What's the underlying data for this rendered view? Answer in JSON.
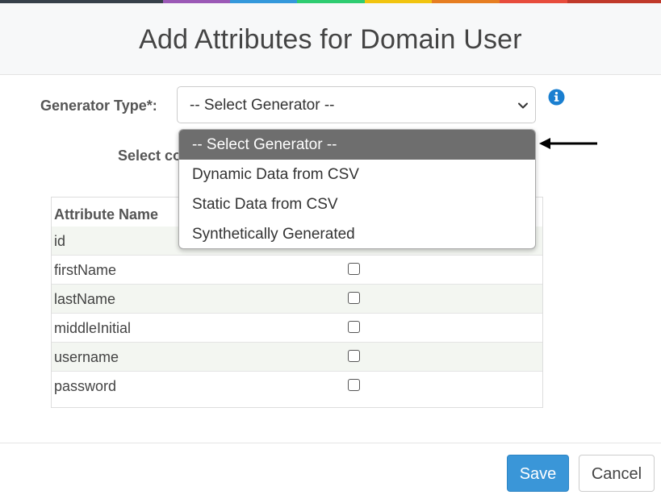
{
  "modal": {
    "title": "Add Attributes for Domain User"
  },
  "top_strip_colors": [
    "#37404a",
    "#37404a",
    "#9b59b6",
    "#3498db",
    "#2ecc71",
    "#f1c40f",
    "#e67e22",
    "#e74c3c",
    "#c0392b"
  ],
  "form": {
    "generator_type_label": "Generator Type*:",
    "generator_select_value": "-- Select Generator --",
    "select_column_label_partial": "Select co"
  },
  "dropdown": {
    "options": [
      "-- Select Generator --",
      "Dynamic Data from CSV",
      "Static Data from CSV",
      "Synthetically Generated"
    ],
    "highlighted_option": "-- Select Generator --"
  },
  "table": {
    "header": "Attribute Name",
    "rows": [
      {
        "name": "id",
        "checked": false
      },
      {
        "name": "firstName",
        "checked": false
      },
      {
        "name": "lastName",
        "checked": false
      },
      {
        "name": "middleInitial",
        "checked": false
      },
      {
        "name": "username",
        "checked": false
      },
      {
        "name": "password",
        "checked": false
      }
    ]
  },
  "footer": {
    "save_label": "Save",
    "cancel_label": "Cancel"
  },
  "colors": {
    "accent": "#3a96d8",
    "info_icon": "#1a7fd0",
    "highlight": "#6e6e6e",
    "row_stripe": "#f3f6f1"
  },
  "icons": {
    "info": "info-circle-icon",
    "chevron": "chevron-down-icon",
    "arrow": "arrow-left-icon"
  }
}
